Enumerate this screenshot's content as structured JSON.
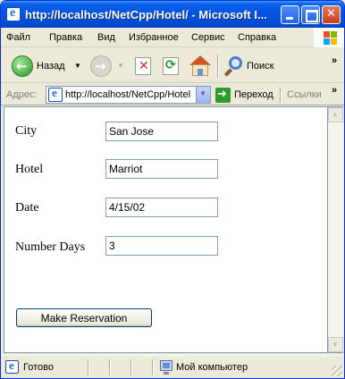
{
  "window": {
    "title": "http://localhost/NetCpp/Hotel/ - Microsoft I..."
  },
  "menu": {
    "items": [
      "Файл",
      "Правка",
      "Вид",
      "Избранное",
      "Сервис",
      "Справка"
    ]
  },
  "toolbar": {
    "back_label": "Назад",
    "search_label": "Поиск",
    "more_glyph": "»"
  },
  "address": {
    "label": "Адрес:",
    "url": "http://localhost/NetCpp/Hotel",
    "go_label": "Переход",
    "links_label": "Ссылки",
    "more_glyph": "»"
  },
  "form": {
    "fields": [
      {
        "label": "City",
        "value": "San Jose"
      },
      {
        "label": "Hotel",
        "value": "Marriot"
      },
      {
        "label": "Date",
        "value": "4/15/02"
      },
      {
        "label": "Number Days",
        "value": "3"
      }
    ],
    "submit_label": "Make Reservation"
  },
  "status": {
    "text": "Готово",
    "zone": "Мой компьютер"
  },
  "colors": {
    "titlebar": "#0055e5",
    "window_border": "#0831d9",
    "input_border": "#7f9db9"
  }
}
